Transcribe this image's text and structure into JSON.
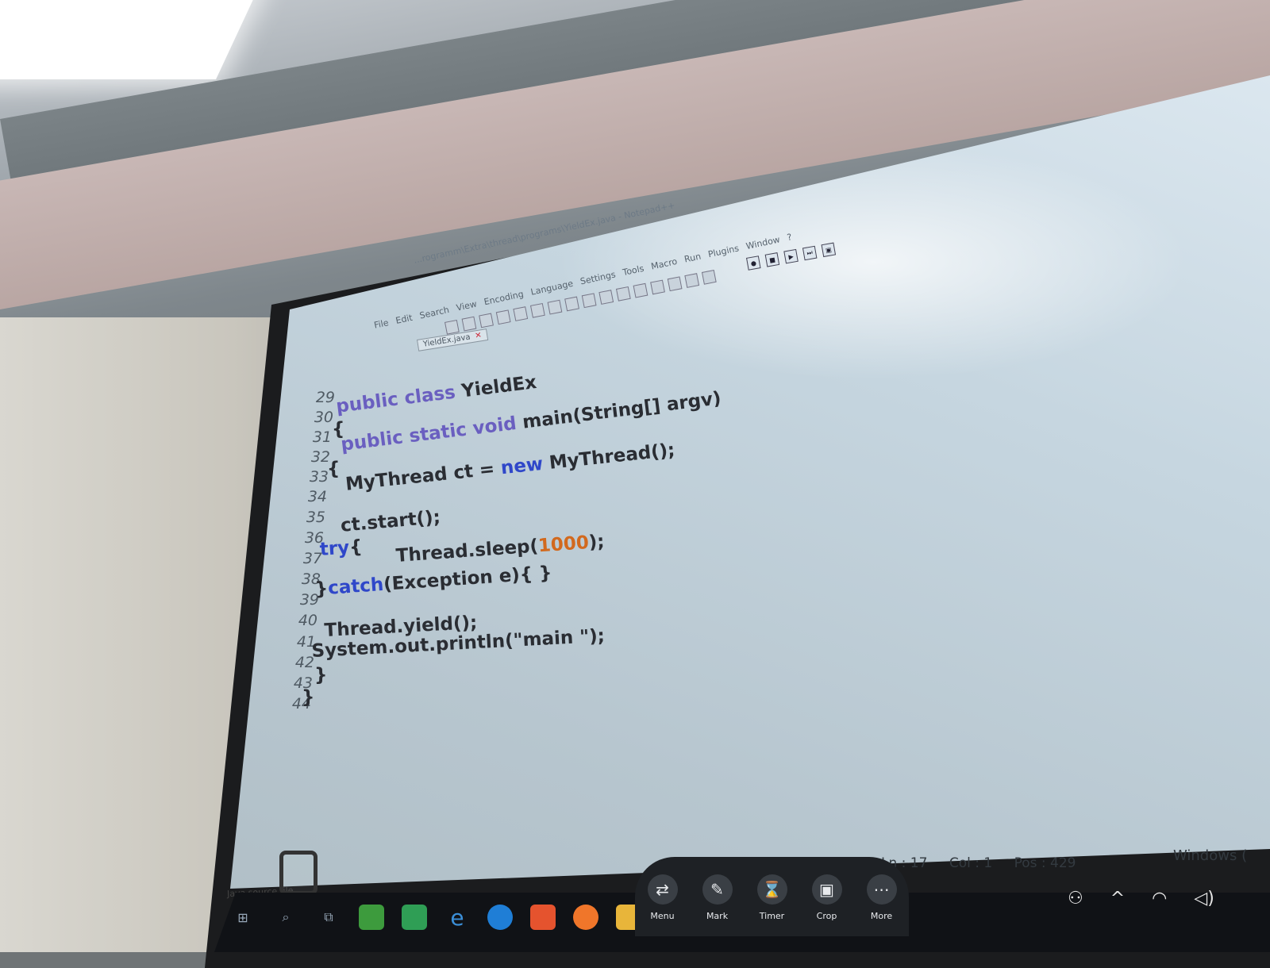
{
  "editor": {
    "title_fragment": "...rogramm\\Extra\\thread\\programs\\YieldEx.java - Notepad++",
    "menu": [
      "File",
      "Edit",
      "Search",
      "View",
      "Encoding",
      "Language",
      "Settings",
      "Tools",
      "Macro",
      "Run",
      "Plugins",
      "Window",
      "?"
    ],
    "tab_label": "YieldEx.java",
    "line_numbers": [
      "29",
      "30",
      "31",
      "32",
      "33",
      "34",
      "35",
      "36",
      "37",
      "38",
      "39",
      "40",
      "41",
      "42",
      "43",
      "44"
    ],
    "code": {
      "l30_kw": "public class",
      "l30_name": " YieldEx",
      "l31": "{",
      "l32_kw": "public static void",
      "l32_rest": " main(String[] argv)",
      "l33": "{",
      "l34_a": "MyThread ct = ",
      "l34_kw": "new",
      "l34_b": " MyThread();",
      "l36": "ct.start();",
      "l37_kw": "try",
      "l37_brace": "{",
      "l38_a": "Thread.sleep(",
      "l38_num": "1000",
      "l38_b": ");",
      "l39_brace": "}",
      "l39_kw": "catch",
      "l39_rest": "(Exception e){ }",
      "l41": "Thread.yield();",
      "l42": "System.out.println(\"main \");",
      "l43": "}",
      "l44": "}"
    },
    "status": {
      "left_label": "Java source file",
      "ln": "Ln : 17",
      "col": "Col : 1",
      "pos": "Pos : 429",
      "eol": "Windows ("
    }
  },
  "floating_toolbar": [
    {
      "label": "Menu",
      "icon": "switch-icon"
    },
    {
      "label": "Mark",
      "icon": "pen-icon"
    },
    {
      "label": "Timer",
      "icon": "hourglass-icon"
    },
    {
      "label": "Crop",
      "icon": "image-icon"
    },
    {
      "label": "More",
      "icon": "more-icon"
    }
  ],
  "colors": {
    "keyword": "#6a5fc0",
    "keyword_blue": "#2f47c9",
    "number": "#d2691e"
  }
}
